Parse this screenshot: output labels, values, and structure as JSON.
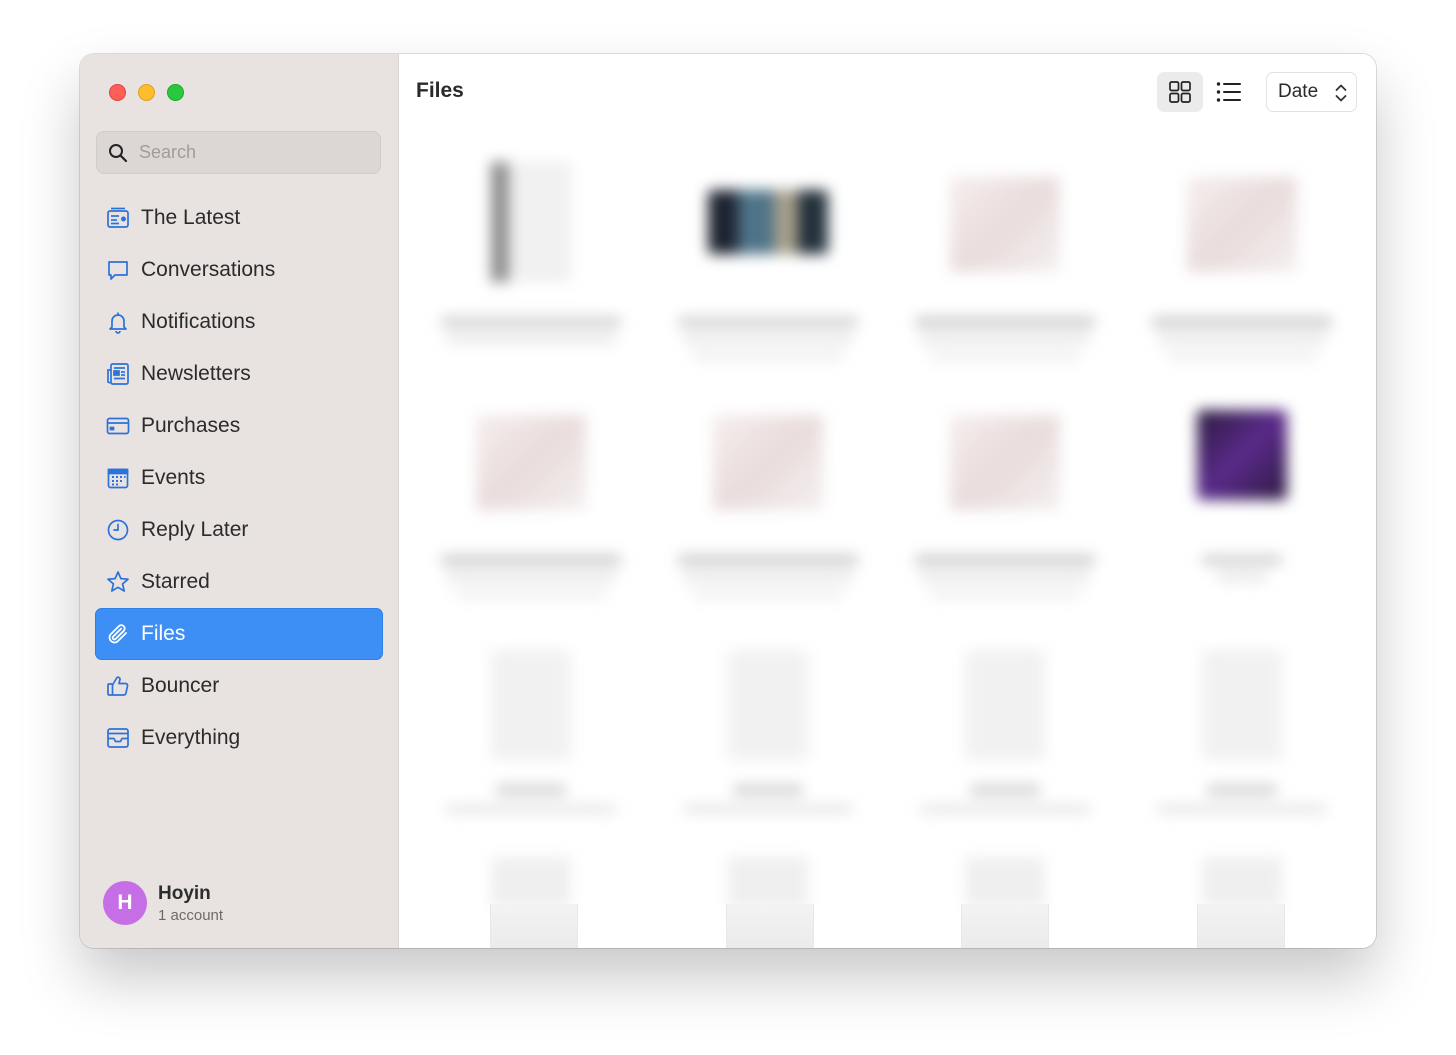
{
  "window": {
    "traffic_lights": [
      "close",
      "minimize",
      "zoom"
    ]
  },
  "search": {
    "placeholder": "Search"
  },
  "sidebar": {
    "items": [
      {
        "label": "The Latest",
        "icon": "latest-icon"
      },
      {
        "label": "Conversations",
        "icon": "chat-bubble-icon"
      },
      {
        "label": "Notifications",
        "icon": "bell-icon"
      },
      {
        "label": "Newsletters",
        "icon": "newspaper-icon"
      },
      {
        "label": "Purchases",
        "icon": "credit-card-icon"
      },
      {
        "label": "Events",
        "icon": "calendar-icon"
      },
      {
        "label": "Reply Later",
        "icon": "clock-icon"
      },
      {
        "label": "Starred",
        "icon": "star-icon"
      },
      {
        "label": "Files",
        "icon": "paperclip-icon",
        "active": true
      },
      {
        "label": "Bouncer",
        "icon": "thumbs-up-icon"
      },
      {
        "label": "Everything",
        "icon": "inbox-tray-icon"
      }
    ]
  },
  "account": {
    "initial": "H",
    "name": "Hoyin",
    "subtitle": "1 account"
  },
  "main": {
    "title": "Files",
    "view_mode": "grid",
    "sort": {
      "label": "Date"
    }
  },
  "colors": {
    "accent": "#3d8ff5",
    "icon_blue": "#2c72d8",
    "sidebar_bg": "#e8e3e1",
    "avatar": "#c56ee6"
  }
}
